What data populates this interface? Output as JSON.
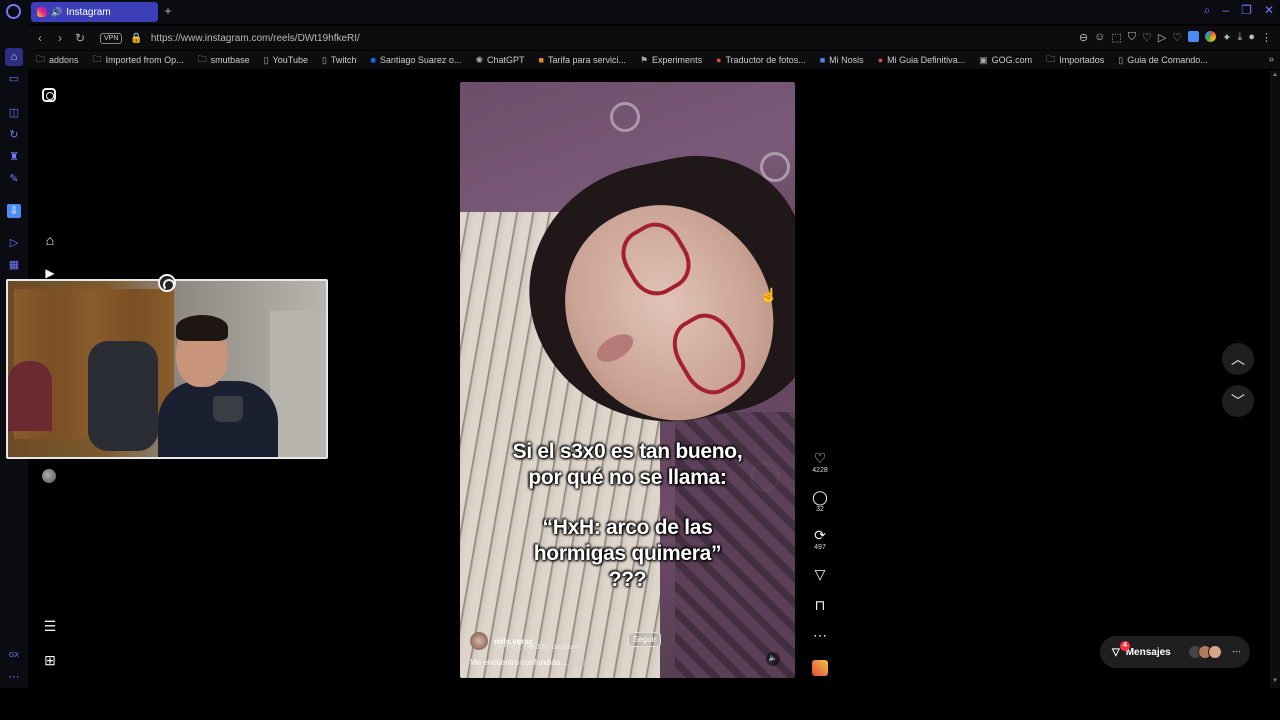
{
  "browser": {
    "tab": {
      "title": "Instagram"
    },
    "url": "https://www.instagram.com/reels/DWt19hfkeRI/",
    "vpn_label": "VPN",
    "bookmarks": [
      "addons",
      "Imported from Op...",
      "smutbase",
      "YouTube",
      "Twitch",
      "Santiago Suarez o...",
      "ChatGPT",
      "Tarifa para servici...",
      "Experiments",
      "Traductor de fotos...",
      "Mi Nosis",
      "Mi Guia Definitiva...",
      "GOG.com",
      "Importados",
      "Guia de Comando..."
    ],
    "sidebar_label": "GX"
  },
  "reel": {
    "caption_line1": "Si el s3x0 es tan bueno,",
    "caption_line2": "por qué no se llama:",
    "caption_line3": "“HxH: arco de las",
    "caption_line4": "hormigas quimera”",
    "caption_line5": "???",
    "username": "mila.verac",
    "audio": "♬ サイズ  小野正利 · departure!",
    "follow_label": "Seguir",
    "description": "Me encuentro confundida ...",
    "more_label": "más"
  },
  "actions": {
    "likes": "4228",
    "comments": "32",
    "reposts": "497"
  },
  "messages": {
    "label": "Mensajes",
    "badge": "4"
  },
  "colors": {
    "accent": "#6f7bff",
    "tab_active": "#3b40b8",
    "notification": "#ff3040"
  }
}
